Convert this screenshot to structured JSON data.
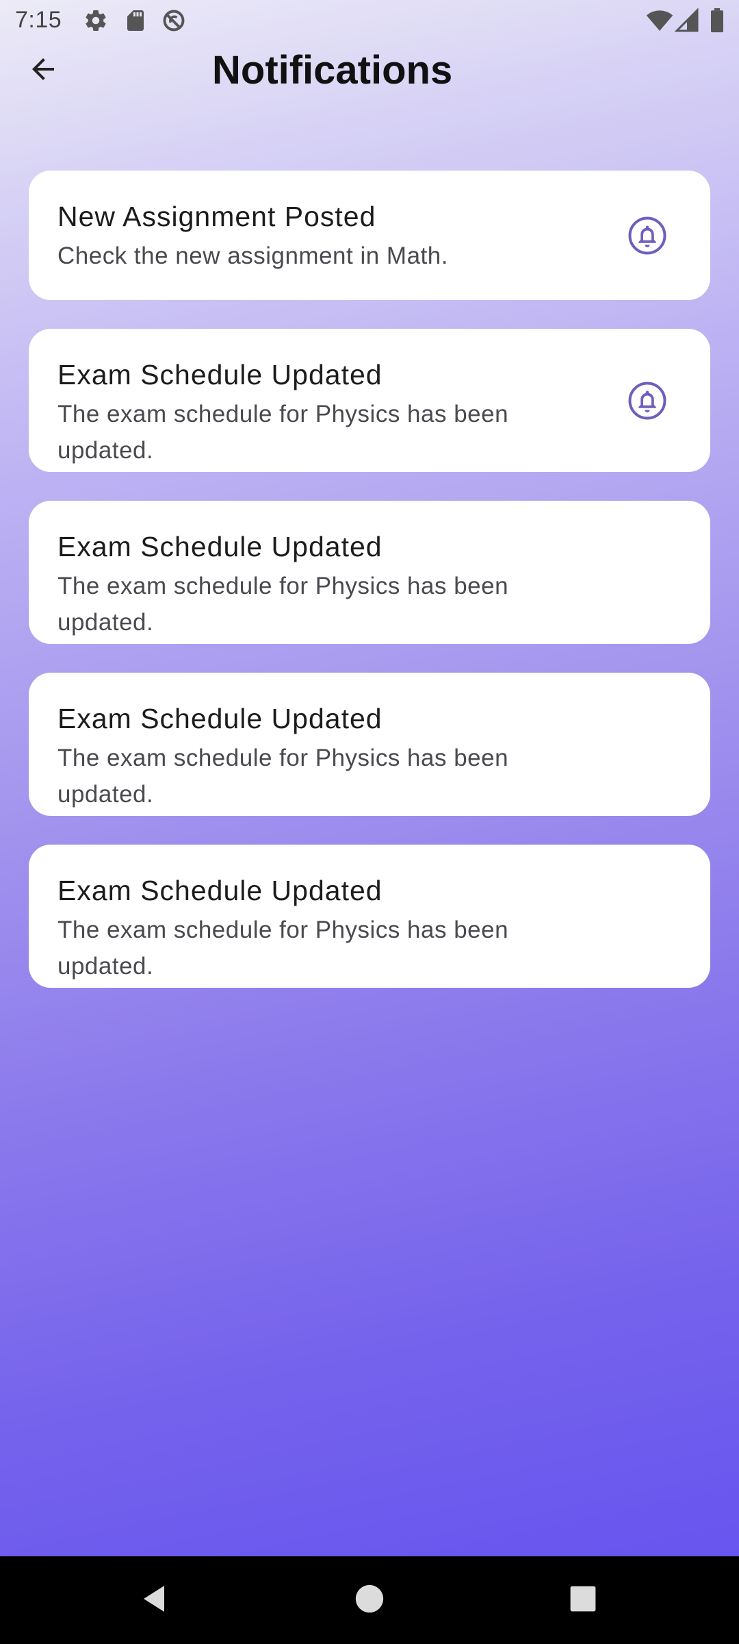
{
  "status_bar": {
    "time": "7:15",
    "left_icons": [
      "settings-icon",
      "sd-card-icon",
      "no-disturb-icon"
    ],
    "right_icons": [
      "wifi-icon",
      "signal-icon",
      "battery-icon"
    ]
  },
  "app_bar": {
    "back_icon": "arrow-back-icon",
    "title": "Notifications"
  },
  "notifications": [
    {
      "title": "New Assignment Posted",
      "body": "Check the new assignment in Math.",
      "has_bell": true
    },
    {
      "title": "Exam Schedule Updated",
      "body": "The exam schedule for Physics has been updated.",
      "has_bell": true
    },
    {
      "title": "Exam Schedule Updated",
      "body": "The exam schedule for Physics has been updated.",
      "has_bell": false
    },
    {
      "title": "Exam Schedule Updated",
      "body": "The exam schedule for Physics has been updated.",
      "has_bell": false
    },
    {
      "title": "Exam Schedule Updated",
      "body": "The exam schedule for Physics has been updated.",
      "has_bell": false
    }
  ],
  "nav_bar": {
    "back": "nav-back-icon",
    "home": "nav-home-icon",
    "recents": "nav-recents-icon"
  },
  "colors": {
    "accent": "#6f5fbd",
    "card": "#ffffff",
    "gradient_top": "#ecebf6",
    "gradient_bottom": "#6755ef"
  }
}
